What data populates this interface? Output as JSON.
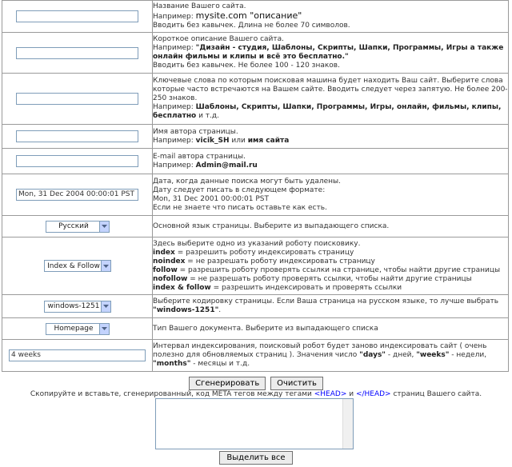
{
  "rows": [
    {
      "field_value": "",
      "lines": [
        "Название Вашего сайта."
      ],
      "example_prefix": "Например: ",
      "example_big": "mysite.com \"описание\"",
      "note": "Вводить без кавычек. Длина не более 70 символов."
    },
    {
      "field_value": "",
      "line1": "Короткое описание Вашего сайта.",
      "example_prefix": "Например: ",
      "example_bold": "\"Дизайн - студия, Шаблоны, Скрипты, Шапки, Программы, Игры а также онлайн фильмы и клипы и всё это бесплатно.\"",
      "note": "Вводить без кавычек. Не более 100 - 120 знаков."
    },
    {
      "field_value": "",
      "line1": "Ключевые слова по которым поисковая машина будет находить Ваш сайт. Выберите слова которые часто встречаются на Вашем сайте. Вводить следует через запятую. Не более 200-250 знаков.",
      "example_prefix": "Например: ",
      "example_bold": "Шаблоны, Скрипты, Шапки, Программы, Игры, онлайн, фильмы, клипы, бесплатно",
      "example_suffix": " и т.д."
    },
    {
      "field_value": "",
      "line1": "Имя автора страницы.",
      "example_prefix": "Например: ",
      "example_bold": "vicik_SH",
      "example_mid": " или ",
      "example_bold2": "имя сайта"
    },
    {
      "field_value": "",
      "line1": "E-mail автора страницы.",
      "example_prefix": "Например: ",
      "example_bold": "Admin@mail.ru"
    },
    {
      "field_value": "Mon, 31 Dec 2004 00:00:01 PST",
      "line1": "Дата, когда данные поиска могут быть удалены.",
      "line2": "Дату следует писать в следующем формате:",
      "line3": "Mon, 31 Dec 2001 00:00:01 PST",
      "line4": "Если не знаете что писать оставьте как есть."
    },
    {
      "select_value": "Русский",
      "line1": "Основной язык страницы. Выберите из выпадающего списка."
    },
    {
      "select_value": "Index & Follow",
      "line1": "Здесь выберите одно из указаний роботу поисковику.",
      "items": [
        {
          "k": "index",
          "t": " = разрешить роботу индексировать страницу"
        },
        {
          "k": "noindex",
          "t": " = не разрешать роботу индексировать страницу"
        },
        {
          "k": "follow",
          "t": " = разрешить роботу проверять ссылки на странице, чтобы найти другие страницы"
        },
        {
          "k": "nofollow",
          "t": " = не разрешать роботу проверять ссылки, чтобы найти другие страницы"
        },
        {
          "k": "index & follow",
          "t": " = разрешить индексировать и проверять ссылки"
        }
      ]
    },
    {
      "select_value": "windows-1251",
      "line1": "Выберите кодировку страницы. Если Ваша страница на русском языке, то лучше выбрать ",
      "bold": "\"windows-1251\"",
      "tail": "."
    },
    {
      "select_value": "Homepage",
      "line1": "Тип Вашего документа. Выберите из выпадающего списка"
    },
    {
      "field_value": "4 weeks",
      "line1": "Интервал индексирования, поисковый робот будет заново индексировать сайт ( очень полезно для обновляемых страниц ). Значения число ",
      "b1": "\"days\"",
      "m1": " - дней, ",
      "b2": "\"weeks\"",
      "m2": " - недели, ",
      "b3": "\"months\"",
      "tail": " - месяцы и т.д."
    }
  ],
  "buttons": {
    "generate": "Сгенерировать",
    "clear": "Очистить",
    "select_all": "Выделить все"
  },
  "copy_text": {
    "before": "Скопируйте и вставьте, сгенерированный, код META тегов между тегами ",
    "tag1": "<HEAD>",
    "mid": " и ",
    "tag2": "</HEAD>",
    "after": " страниц Вашего сайта."
  },
  "output_code": ""
}
